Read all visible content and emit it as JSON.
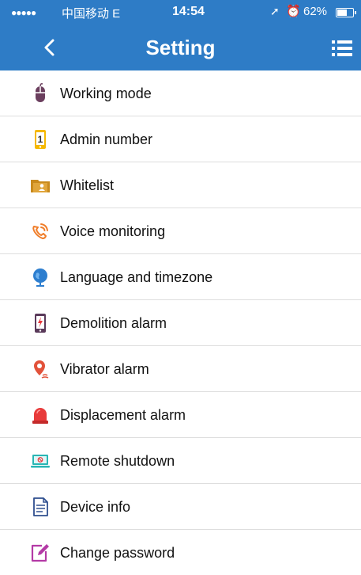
{
  "status_bar": {
    "signal": "●●●●●",
    "carrier": "中国移动  E",
    "time": "14:54",
    "location_glyph": "➚",
    "alarm_glyph": "⏰",
    "battery": "62%"
  },
  "header": {
    "title": "Setting",
    "back_icon": "chevron-left-icon",
    "menu_icon": "list-menu-icon",
    "background": "#2e7cc6"
  },
  "settings": {
    "items": [
      {
        "label": "Working mode",
        "icon": "mouse-icon",
        "color": "#6b3f5e"
      },
      {
        "label": "Admin number",
        "icon": "phone-one-icon",
        "color": "#f5b800"
      },
      {
        "label": "Whitelist",
        "icon": "folder-contact-icon",
        "color": "#c98a1c"
      },
      {
        "label": "Voice monitoring",
        "icon": "phone-ring-icon",
        "color": "#f07e2a"
      },
      {
        "label": "Language and timezone",
        "icon": "globe-icon",
        "color": "#2d7ecf"
      },
      {
        "label": "Demolition alarm",
        "icon": "phone-lightning-icon",
        "color": "#5a3a5a"
      },
      {
        "label": "Vibrator alarm",
        "icon": "pin-vibrate-icon",
        "color": "#e2523a"
      },
      {
        "label": "Displacement alarm",
        "icon": "siren-icon",
        "color": "#e83b3b"
      },
      {
        "label": "Remote shutdown",
        "icon": "laptop-shutdown-icon",
        "color": "#29b6b4"
      },
      {
        "label": "Device info",
        "icon": "document-icon",
        "color": "#2f4f8f"
      },
      {
        "label": "Change password",
        "icon": "edit-icon",
        "color": "#b43aa6"
      }
    ]
  }
}
